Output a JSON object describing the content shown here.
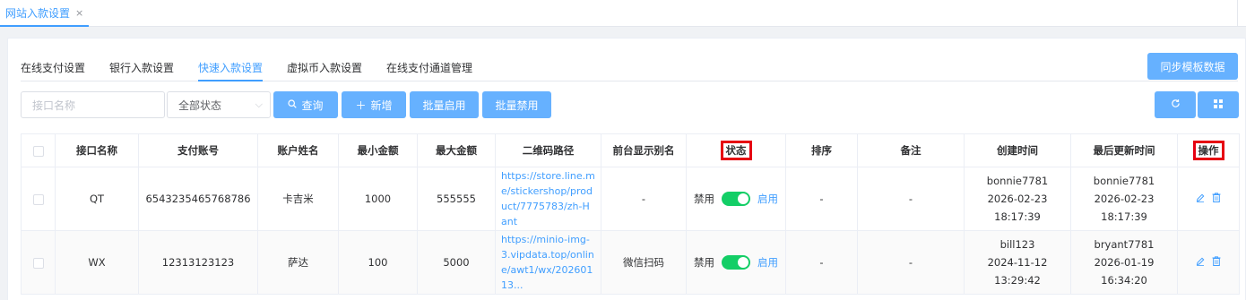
{
  "page_tab": {
    "label": "网站入款设置",
    "close": "×"
  },
  "tabs": [
    "在线支付设置",
    "银行入款设置",
    "快速入款设置",
    "虚拟币入款设置",
    "在线支付通道管理"
  ],
  "active_tab": "快速入款设置",
  "sync_button": "同步模板数据",
  "filters": {
    "name_placeholder": "接口名称",
    "status_value": "全部状态",
    "query": "查询",
    "add": "新增",
    "batch_enable": "批量启用",
    "batch_disable": "批量禁用"
  },
  "icons": {
    "search": "search-icon",
    "plus": "plus-icon",
    "refresh": "refresh-icon",
    "grid": "grid-icon",
    "edit": "edit-icon",
    "delete": "delete-icon"
  },
  "highlight_color": "#e60012",
  "table": {
    "headers": [
      "接口名称",
      "支付账号",
      "账户姓名",
      "最小金额",
      "最大金额",
      "二维码路径",
      "前台显示别名",
      "状态",
      "排序",
      "备注",
      "创建时间",
      "最后更新时间",
      "操作"
    ],
    "rows": [
      {
        "name": "QT",
        "account": "6543235465768786",
        "holder": "卡吉米",
        "min": "1000",
        "max": "555555",
        "qr": "https://store.line.me/stickershop/product/7775783/zh-Hant",
        "alias": "-",
        "status_off": "禁用",
        "status_on": "启用",
        "enabled": true,
        "sort": "-",
        "remark": "-",
        "created_by": "bonnie7781",
        "created_at": "2026-02-23 18:17:39",
        "updated_by": "bonnie7781",
        "updated_at": "2026-02-23 18:17:39"
      },
      {
        "name": "WX",
        "account": "12313123123",
        "holder": "萨达",
        "min": "100",
        "max": "5000",
        "qr": "https://minio-img-3.vipdata.top/online/awt1/wx/20260113...",
        "alias": "微信扫码",
        "status_off": "禁用",
        "status_on": "启用",
        "enabled": true,
        "sort": "-",
        "remark": "-",
        "created_by": "bill123",
        "created_at": "2024-11-12 13:29:42",
        "updated_by": "bryant7781",
        "updated_at": "2026-01-19 16:34:20"
      }
    ]
  }
}
